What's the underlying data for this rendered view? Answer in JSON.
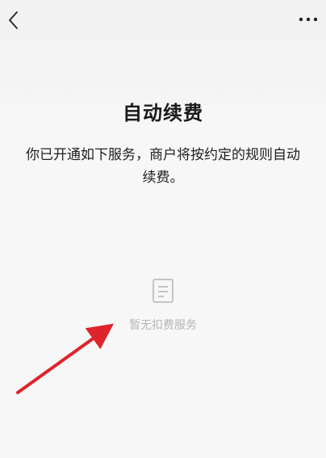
{
  "page": {
    "title": "自动续费",
    "description": "你已开通如下服务，商户将按约定的规则自动续费。",
    "empty_state": {
      "icon": "document-icon",
      "text": "暂无扣费服务"
    }
  },
  "nav": {
    "back_icon": "chevron-left-icon",
    "more_icon": "more-dots-icon"
  },
  "annotation": {
    "color": "#e0232b"
  }
}
